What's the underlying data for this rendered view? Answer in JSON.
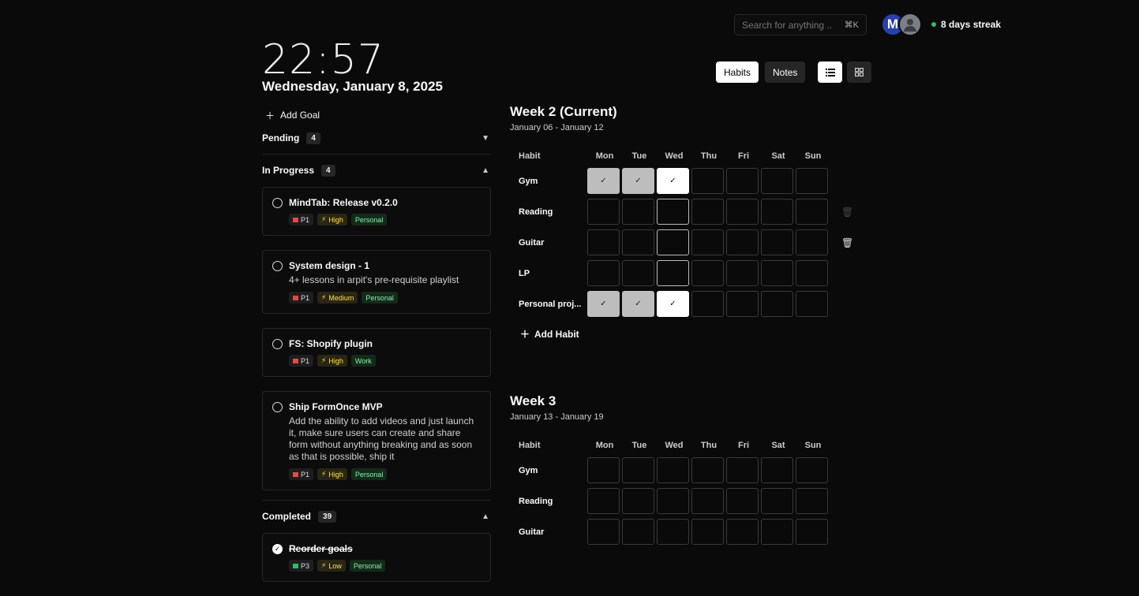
{
  "header": {
    "search_placeholder": "Search for anything ...",
    "search_shortcut": "⌘K",
    "avatar_initial": "M",
    "streak": "8 days streak"
  },
  "clock": {
    "time": "22:57",
    "date": "Wednesday, January 8, 2025"
  },
  "goals": {
    "add_label": "Add Goal",
    "sections": {
      "pending": {
        "label": "Pending",
        "count": "4"
      },
      "in_progress": {
        "label": "In Progress",
        "count": "4"
      },
      "completed": {
        "label": "Completed",
        "count": "39"
      }
    },
    "in_progress_items": [
      {
        "title": "MindTab: Release v0.2.0",
        "desc": "",
        "p": "P1",
        "priority": "High",
        "category": "Personal"
      },
      {
        "title": "System design - 1",
        "desc": "4+ lessons in arpit's pre-requisite playlist",
        "p": "P1",
        "priority": "Medium",
        "category": "Personal"
      },
      {
        "title": "FS: Shopify plugin",
        "desc": "",
        "p": "P1",
        "priority": "High",
        "category": "Work"
      },
      {
        "title": "Ship FormOnce MVP",
        "desc": "Add the ability to add videos and just launch it, make sure users can create and share form without anything breaking and as soon as that is possible, ship it",
        "p": "P1",
        "priority": "High",
        "category": "Personal"
      }
    ],
    "completed_items": [
      {
        "title": "Reorder goals",
        "p": "P3",
        "priority": "Low",
        "category": "Personal"
      }
    ]
  },
  "toggles": {
    "habits": "Habits",
    "notes": "Notes"
  },
  "habit_header": {
    "habit": "Habit",
    "days": [
      "Mon",
      "Tue",
      "Wed",
      "Thu",
      "Fri",
      "Sat",
      "Sun"
    ]
  },
  "weeks": [
    {
      "title": "Week 2 (Current)",
      "range": "January 06 - January 12",
      "habits": [
        {
          "name": "Gym",
          "checks": [
            "past",
            "past",
            "today",
            "",
            "",
            "",
            ""
          ]
        },
        {
          "name": "Reading",
          "checks": [
            "",
            "",
            "todayempty",
            "",
            "",
            "",
            ""
          ]
        },
        {
          "name": "Guitar",
          "checks": [
            "",
            "",
            "todayempty",
            "",
            "",
            "",
            ""
          ]
        },
        {
          "name": "LP",
          "checks": [
            "",
            "",
            "todayempty",
            "",
            "",
            "",
            ""
          ]
        },
        {
          "name": "Personal proj...",
          "checks": [
            "past",
            "past",
            "today",
            "",
            "",
            "",
            ""
          ]
        }
      ]
    },
    {
      "title": "Week 3",
      "range": "January 13 - January 19",
      "habits": [
        {
          "name": "Gym",
          "checks": [
            "",
            "",
            "",
            "",
            "",
            "",
            ""
          ]
        },
        {
          "name": "Reading",
          "checks": [
            "",
            "",
            "",
            "",
            "",
            "",
            ""
          ]
        },
        {
          "name": "Guitar",
          "checks": [
            "",
            "",
            "",
            "",
            "",
            "",
            ""
          ]
        }
      ]
    }
  ],
  "add_habit_label": "Add Habit"
}
